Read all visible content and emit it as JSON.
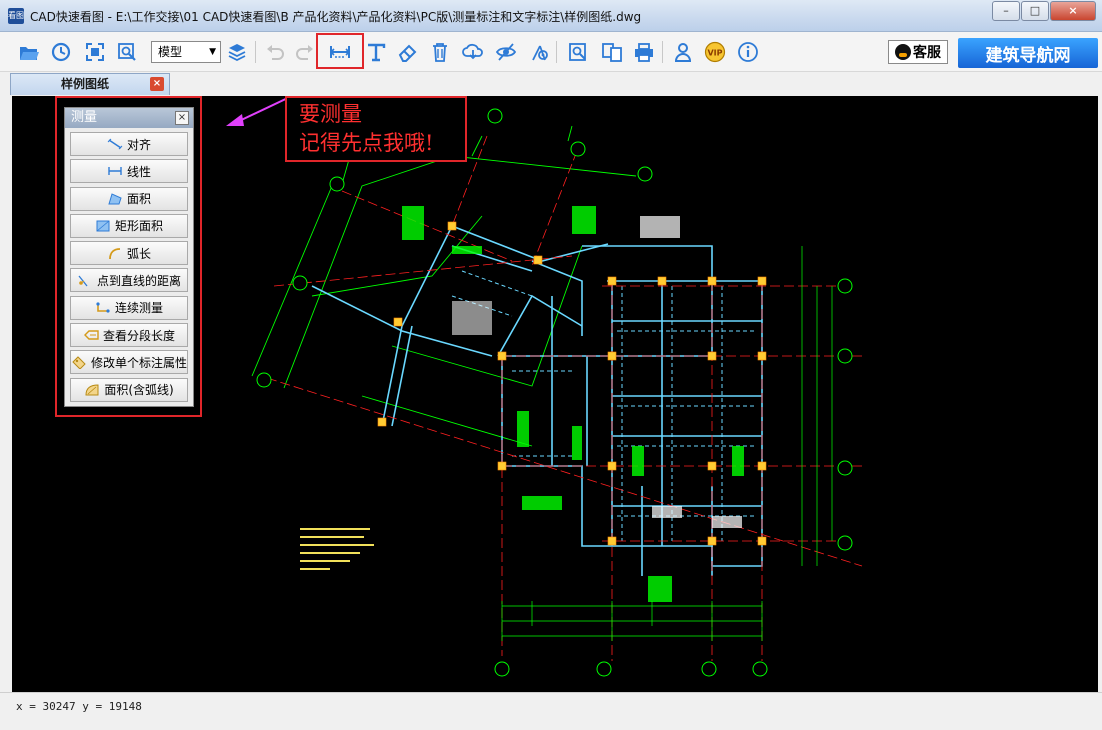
{
  "window": {
    "title": "CAD快速看图 - E:\\工作交接\\01 CAD快速看图\\B 产品化资料\\产品化资料\\PC版\\测量标注和文字标注\\样例图纸.dwg",
    "app_icon_text": "看图",
    "min_label": "–",
    "max_label": "□",
    "close_label": "×"
  },
  "toolbar": {
    "model_select_value": "模型",
    "kefu_label": "客服",
    "nav_label": "建筑导航网",
    "tools": [
      "open-icon",
      "history-icon",
      "zoom-extents-icon",
      "zoom-window-icon",
      "model-select",
      "layers-icon",
      "undo-icon",
      "redo-icon",
      "measure-icon",
      "text-icon",
      "eraser-icon",
      "delete-icon",
      "cloud-download-icon",
      "hide-icon",
      "settings-icon",
      "find-icon",
      "export-icon",
      "print-icon",
      "user-icon",
      "vip-icon",
      "info-icon"
    ]
  },
  "tab": {
    "label": "样例图纸",
    "close_label": "×"
  },
  "measure_panel": {
    "title": "测量",
    "close_label": "×",
    "items": [
      {
        "label": "对齐",
        "icon": "align-icon"
      },
      {
        "label": "线性",
        "icon": "linear-icon"
      },
      {
        "label": "面积",
        "icon": "area-icon"
      },
      {
        "label": "矩形面积",
        "icon": "rect-area-icon"
      },
      {
        "label": "弧长",
        "icon": "arc-length-icon"
      },
      {
        "label": "点到直线的距离",
        "icon": "point-line-distance-icon"
      },
      {
        "label": "连续测量",
        "icon": "continuous-measure-icon"
      },
      {
        "label": "查看分段长度",
        "icon": "segment-length-icon"
      },
      {
        "label": "修改单个标注属性",
        "icon": "edit-dimension-icon"
      },
      {
        "label": "面积(含弧线)",
        "icon": "arc-area-icon"
      }
    ]
  },
  "callout": {
    "line1": "要测量",
    "line2": "记得先点我哦!"
  },
  "status": {
    "coords": "x = 30247  y = 19148"
  },
  "colors": {
    "highlight": "#e0262a",
    "callout_text": "#ff3030",
    "arrow": "#e040fb",
    "canvas_bg": "#000000",
    "cad_green": "#00ff00",
    "cad_cyan": "#6ad8ff",
    "cad_red": "#ff2020",
    "cad_white": "#ffffff"
  }
}
